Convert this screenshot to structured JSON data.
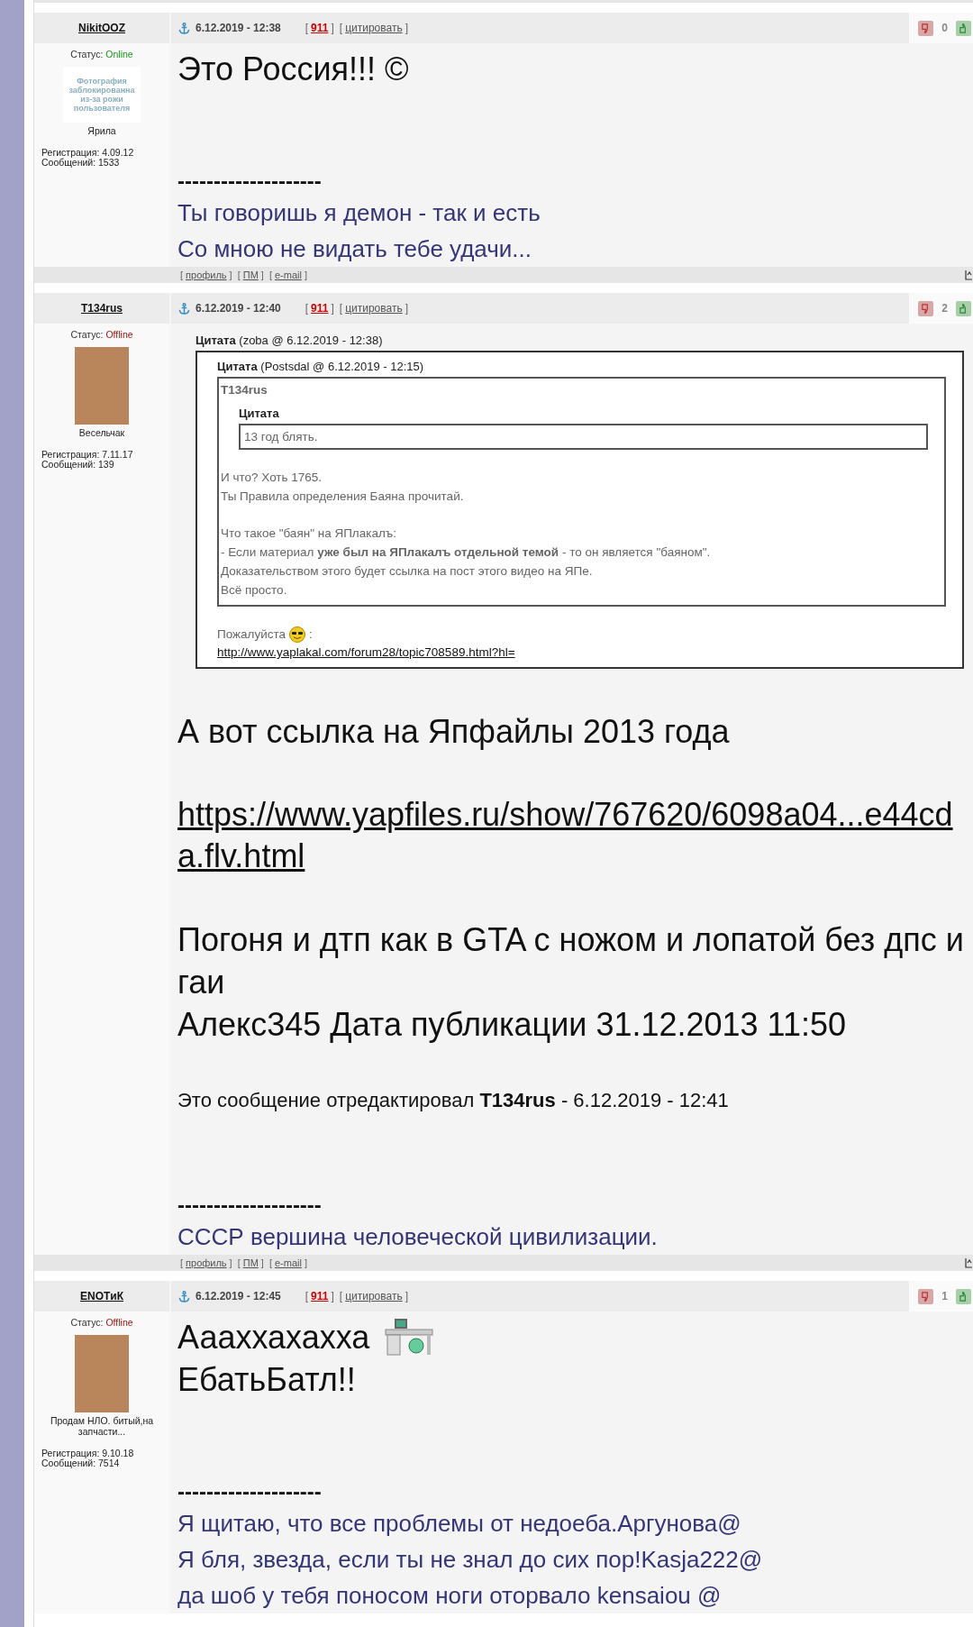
{
  "posts": [
    {
      "author": "NikitOOZ",
      "status_label": "Статус:",
      "status": "Online",
      "online": true,
      "avatar": {
        "kind": "text",
        "text": "Фотография заблокированна из-за рожи пользователя"
      },
      "rank": "Ярила",
      "registration": "Регистрация: 4.09.12",
      "messages": "Сообщений: 1533",
      "date": "6.12.2019 - 12:38",
      "links": [
        {
          "open": "[",
          "label": "911",
          "close": "]",
          "kind": "complaint"
        },
        {
          "open": "[",
          "label": "цитировать",
          "close": "]",
          "kind": "quote"
        }
      ],
      "rating": "0",
      "body": [
        {
          "kind": "text",
          "text": "Это Россия!!! ©"
        }
      ],
      "signature": {
        "divider": "--------------------",
        "lines": [
          "Ты говоришь я демон - так и есть",
          "Со мною не видать тебе удачи..."
        ]
      },
      "footer_links": [
        {
          "open": "[",
          "label": "профиль",
          "close": "]"
        },
        {
          "open": "[",
          "label": "ПМ",
          "close": "]"
        },
        {
          "open": "[",
          "label": "e-mail",
          "close": "]"
        }
      ]
    },
    {
      "author": "T134rus",
      "status_label": "Статус:",
      "status": "Offline",
      "online": false,
      "avatar": {
        "kind": "photo"
      },
      "rank": "Весельчак",
      "registration": "Регистрация: 7.11.17",
      "messages": "Сообщений: 139",
      "date": "6.12.2019 - 12:40",
      "links": [
        {
          "open": "[",
          "label": "911",
          "close": "]",
          "kind": "complaint"
        },
        {
          "open": "[",
          "label": "цитировать",
          "close": "]",
          "kind": "quote"
        }
      ],
      "rating": "2",
      "body": [
        {
          "kind": "quote",
          "header": "**Цитата** (zoba @ 6.12.2019 - 12:38)",
          "items": [
            {
              "kind": "quote",
              "header": "**Цитата** (Postsdal @ 6.12.2019 - 12:15)",
              "items": [
                {
                  "kind": "line",
                  "text": "**T134rus**"
                },
                {
                  "kind": "quote",
                  "header": "**Цитата**",
                  "items": [
                    {
                      "kind": "line",
                      "text": "13 год блять."
                    }
                  ]
                },
                {
                  "kind": "gap"
                },
                {
                  "kind": "line",
                  "text": "И что? Хоть 1765."
                },
                {
                  "kind": "line",
                  "text": "Ты Правила определения Баяна прочитай."
                },
                {
                  "kind": "gap"
                },
                {
                  "kind": "line",
                  "text": "Что такое \"баян\" на ЯПлакалъ:"
                },
                {
                  "kind": "line",
                  "text": "- Если материал **уже был на ЯПлакалъ отдельной темой** - то он является \"баяном\"."
                },
                {
                  "kind": "line",
                  "text": "Доказательством этого будет ссылка на пост этого видео на ЯПе."
                },
                {
                  "kind": "line",
                  "text": "Всё просто."
                }
              ]
            },
            {
              "kind": "gap"
            },
            {
              "kind": "line",
              "text": "Пожалуйста",
              "emoticon": {
                "kind": "cool"
              },
              "after": ":"
            },
            {
              "kind": "link",
              "text": "http://www.yaplakal.com/forum28/topic708589.html?hl="
            }
          ]
        },
        {
          "kind": "gap"
        },
        {
          "kind": "text",
          "text": "А вот ссылка на Япфайлы 2013 года"
        },
        {
          "kind": "gap"
        },
        {
          "kind": "link",
          "text": "https://www.yapfiles.ru/show/767620/6098a04...e44cda.flv.html"
        },
        {
          "kind": "gap"
        },
        {
          "kind": "text",
          "text": "Погоня и дтп как в GTA с ножом и лопатой без дпс и гаи"
        },
        {
          "kind": "text",
          "text": "Алекс345 Дата публикации 31.12.2013 11:50"
        },
        {
          "kind": "gap"
        },
        {
          "kind": "edit_note",
          "text": "Это сообщение отредактировал **T134rus** - 6.12.2019 - 12:41"
        }
      ],
      "signature": {
        "divider": "--------------------",
        "lines": [
          "СССР вершина человеческой цивилизации."
        ]
      },
      "footer_links": [
        {
          "open": "[",
          "label": "профиль",
          "close": "]"
        },
        {
          "open": "[",
          "label": "ПМ",
          "close": "]"
        },
        {
          "open": "[",
          "label": "e-mail",
          "close": "]"
        }
      ]
    },
    {
      "author": "ENOTиК",
      "status_label": "Статус:",
      "status": "Offline",
      "online": false,
      "avatar": {
        "kind": "photo"
      },
      "rank": "Продам НЛО. битый,на запчасти...",
      "registration": "Регистрация: 9.10.18",
      "messages": "Сообщений: 7514",
      "date": "6.12.2019 - 12:45",
      "links": [
        {
          "open": "[",
          "label": "911",
          "close": "]",
          "kind": "complaint"
        },
        {
          "open": "[",
          "label": "цитировать",
          "close": "]",
          "kind": "quote"
        }
      ],
      "rating": "1",
      "body": [
        {
          "kind": "text",
          "text": "Аааххахахха",
          "emoticon": {
            "kind": "computer"
          }
        },
        {
          "kind": "text",
          "text": "ЕбатьБатл!!"
        }
      ],
      "signature": {
        "divider": "--------------------",
        "lines": [
          "Я щитаю, что все проблемы от недоеба.Аргунова@",
          "Я бля, звезда, если ты не знал до сих пор!Kasja222@",
          "да шоб у тебя поносом ноги оторвало kensaiou @"
        ]
      }
    }
  ]
}
